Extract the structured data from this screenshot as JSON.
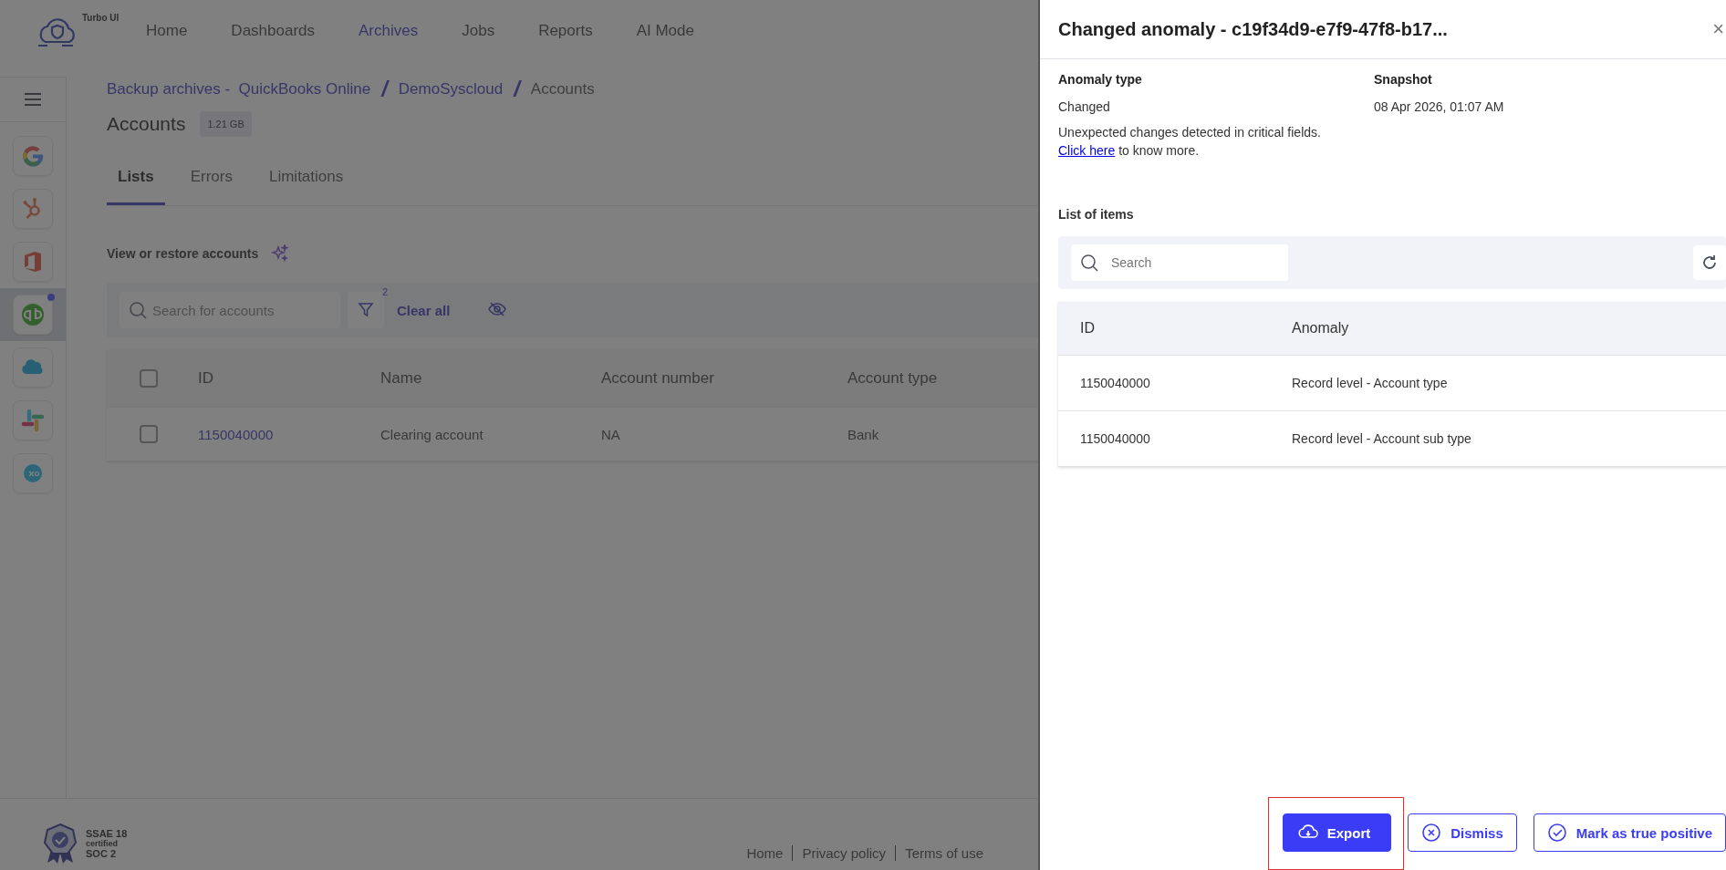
{
  "header": {
    "logo_text": "Turbo UI",
    "nav": [
      {
        "label": "Home",
        "selected": false
      },
      {
        "label": "Dashboards",
        "selected": false
      },
      {
        "label": "Archives",
        "selected": true
      },
      {
        "label": "Jobs",
        "selected": false
      },
      {
        "label": "Reports",
        "selected": false
      },
      {
        "label": "AI Mode",
        "selected": false
      }
    ]
  },
  "sidebar": {
    "items": [
      {
        "kind": "google",
        "selected": false,
        "dot": false
      },
      {
        "kind": "hubspot",
        "selected": false,
        "dot": false
      },
      {
        "kind": "office",
        "selected": false,
        "dot": false
      },
      {
        "kind": "quickbooks",
        "selected": true,
        "dot": true
      },
      {
        "kind": "salesforce",
        "selected": false,
        "dot": false
      },
      {
        "kind": "slack",
        "selected": false,
        "dot": false
      },
      {
        "kind": "xero",
        "selected": false,
        "dot": false
      }
    ]
  },
  "breadcrumb": [
    {
      "kind": "link",
      "text": "Backup archives -  QuickBooks Online"
    },
    {
      "kind": "separator",
      "text": "/"
    },
    {
      "kind": "link",
      "text": "DemoSyscloud"
    },
    {
      "kind": "separator",
      "text": "/"
    },
    {
      "kind": "current",
      "text": "Accounts"
    }
  ],
  "page": {
    "title": "Accounts",
    "size": "1.21 GB"
  },
  "tabs": [
    {
      "label": "Lists",
      "selected": true
    },
    {
      "label": "Errors",
      "selected": false
    },
    {
      "label": "Limitations",
      "selected": false
    }
  ],
  "section_title": "View or restore accounts",
  "toolbar": {
    "search_placeholder": "Search for accounts",
    "filter_count": "2",
    "clear_label": "Clear all"
  },
  "table": {
    "all_checked": false,
    "columns": [
      "ID",
      "Name",
      "Account number",
      "Account type"
    ],
    "rows": [
      {
        "checked": false,
        "cells": [
          "1150040000",
          "Clearing account",
          "NA",
          "Bank"
        ]
      }
    ]
  },
  "footer": {
    "badge": [
      "SSAE 18",
      "certified",
      "SOC 2"
    ],
    "links": [
      "Home",
      "Privacy policy",
      "Terms of use"
    ]
  },
  "drawer": {
    "title": "Changed anomaly - c19f34d9-e7f9-47f8-b17...",
    "close": "×",
    "fields": [
      {
        "label": "Anomaly type",
        "value": "Changed"
      },
      {
        "label": "Snapshot",
        "value": "08 Apr 2026, 01:07 AM"
      }
    ],
    "description": "Unexpected changes detected in critical fields.",
    "link": "Click here",
    "link_suffix": " to know more.",
    "list_title": "List of items",
    "search_placeholder": "Search",
    "columns": [
      "ID",
      "Anomaly"
    ],
    "rows": [
      [
        "1150040000",
        "Record level - Account type"
      ],
      [
        "1150040000",
        "Record level - Account sub type"
      ]
    ],
    "buttons": [
      {
        "kind": "primary",
        "label": "Export",
        "highlighted": true
      },
      {
        "kind": "dismiss",
        "label": "Dismiss",
        "highlighted": false
      },
      {
        "kind": "confirm",
        "label": "Mark as true positive",
        "highlighted": false
      }
    ]
  }
}
